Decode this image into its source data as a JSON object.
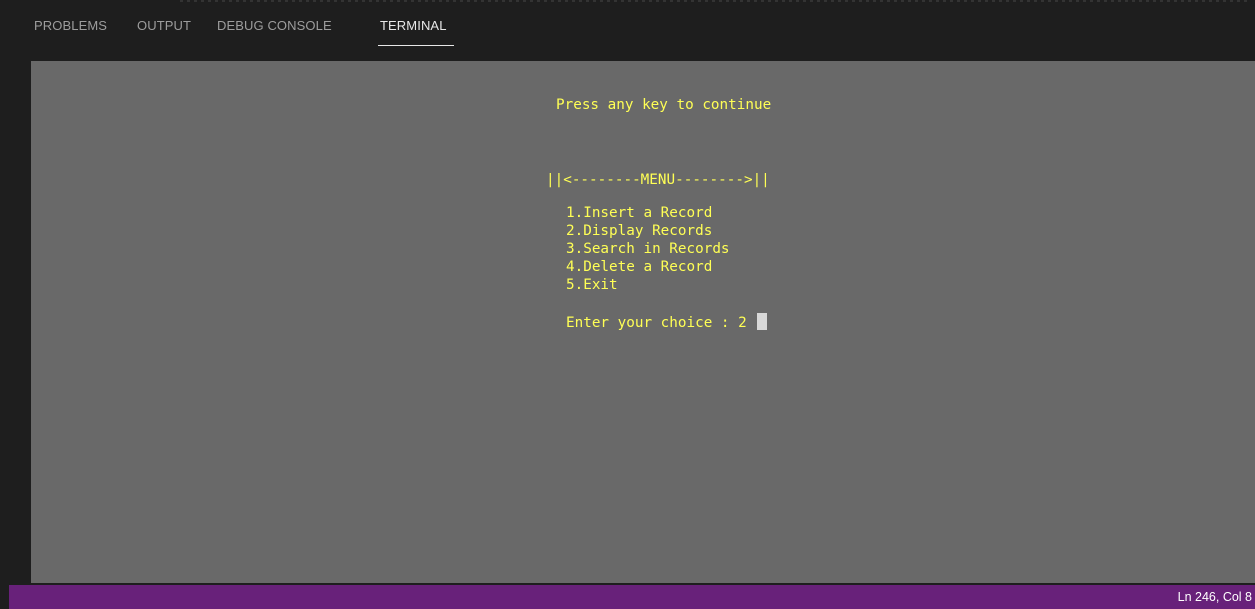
{
  "panel": {
    "tabs": [
      {
        "label": "PROBLEMS",
        "active": false
      },
      {
        "label": "OUTPUT",
        "active": false
      },
      {
        "label": "DEBUG CONSOLE",
        "active": false
      },
      {
        "label": "TERMINAL",
        "active": true
      }
    ]
  },
  "terminal": {
    "prompt_continue": "Press any key to continue",
    "menu_header": "||<--------MENU-------->||",
    "menu_items": [
      "1.Insert a Record",
      "2.Display Records",
      "3.Search in Records",
      "4.Delete a Record",
      "5.Exit"
    ],
    "choice_prompt": "Enter your choice : 2 ",
    "text_color": "#ffff55",
    "background_color": "#696969"
  },
  "statusbar": {
    "position": "Ln 246, Col 8",
    "color": "#68217a"
  }
}
